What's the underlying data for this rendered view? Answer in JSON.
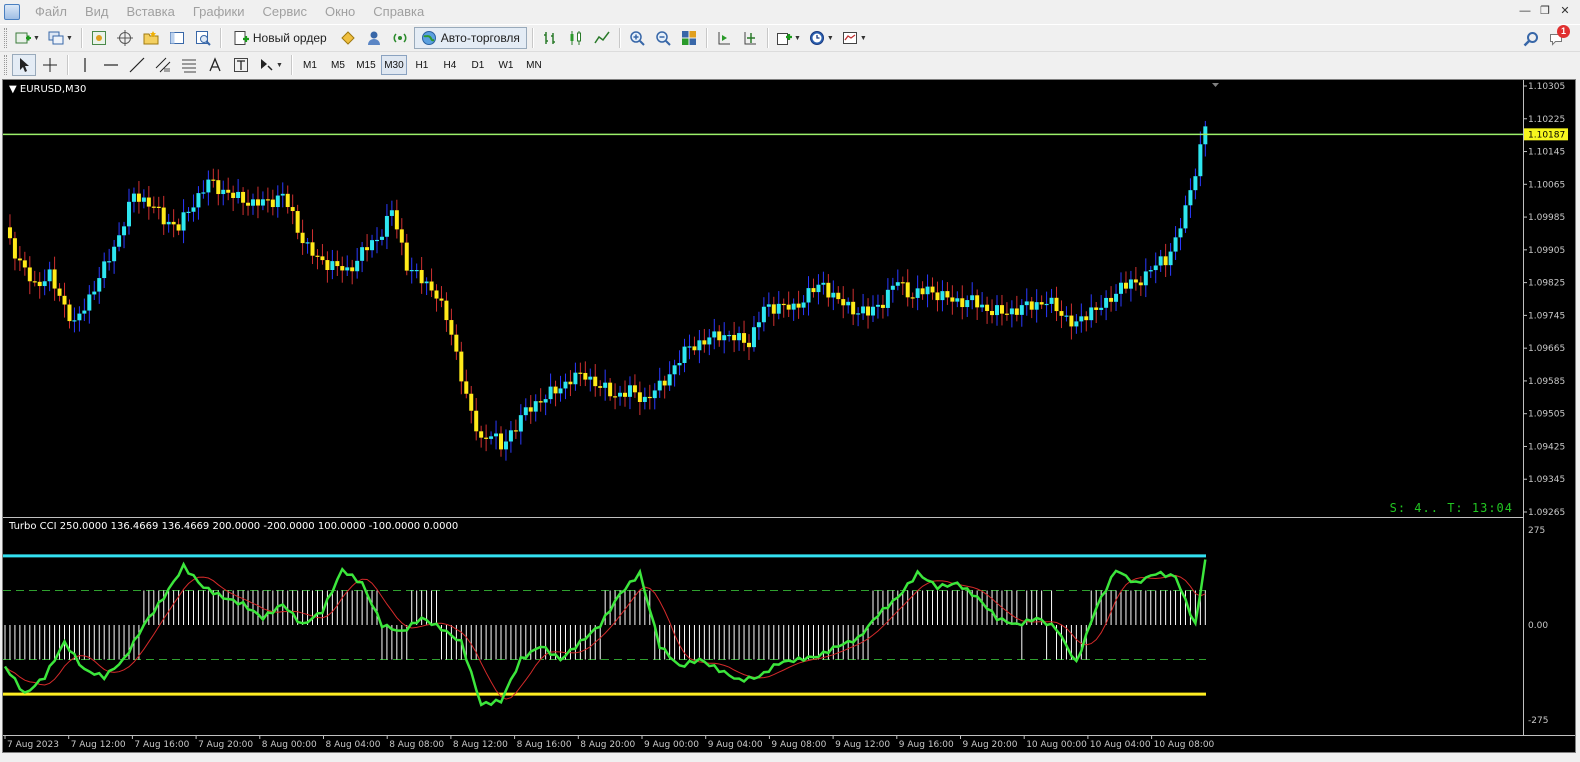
{
  "menu": {
    "items": [
      "Файл",
      "Вид",
      "Вставка",
      "Графики",
      "Сервис",
      "Окно",
      "Справка"
    ]
  },
  "toolbar": {
    "new_order_label": "Новый ордер",
    "autotrading_label": "Авто-торговля",
    "notifications_count": "1"
  },
  "timeframes": [
    "M1",
    "M5",
    "M15",
    "M30",
    "H1",
    "H4",
    "D1",
    "W1",
    "MN"
  ],
  "active_timeframe": "M30",
  "chart": {
    "symbol_title": "EURUSD,M30",
    "current_price": "1.10187",
    "price_axis": [
      "1.10305",
      "1.10225",
      "1.10145",
      "1.10065",
      "1.09985",
      "1.09905",
      "1.09825",
      "1.09745",
      "1.09665",
      "1.09585",
      "1.09505",
      "1.09425",
      "1.09345",
      "1.09265"
    ],
    "time_axis": [
      "7 Aug 2023",
      "7 Aug 12:00",
      "7 Aug 16:00",
      "7 Aug 20:00",
      "8 Aug 00:00",
      "8 Aug 04:00",
      "8 Aug 08:00",
      "8 Aug 12:00",
      "8 Aug 16:00",
      "8 Aug 20:00",
      "9 Aug 00:00",
      "9 Aug 04:00",
      "9 Aug 08:00",
      "9 Aug 12:00",
      "9 Aug 16:00",
      "9 Aug 20:00",
      "10 Aug 00:00",
      "10 Aug 04:00",
      "10 Aug 08:00"
    ],
    "server_time": "S: 4.. T: 13:04",
    "colors": {
      "bull": "#2ee6f0",
      "bear": "#ffea1a",
      "wick_bull": "#2a3aff",
      "wick_bear": "#d03030",
      "price_line": "#9cf06a"
    }
  },
  "indicator": {
    "title": "Turbo CCI 250.0000 136.4669 136.4669 200.0000 -200.0000 100.0000 -100.0000 0.0000",
    "axis": [
      "275",
      "0.00",
      "-275"
    ],
    "levels": {
      "upper": 200,
      "lower": -200,
      "dash_upper": 100,
      "dash_lower": -100
    },
    "colors": {
      "cci": "#3ce63c",
      "signal": "#d42a2a",
      "upper_level": "#33e0f0",
      "lower_level": "#ffee22",
      "hist": "#ffffff"
    }
  }
}
